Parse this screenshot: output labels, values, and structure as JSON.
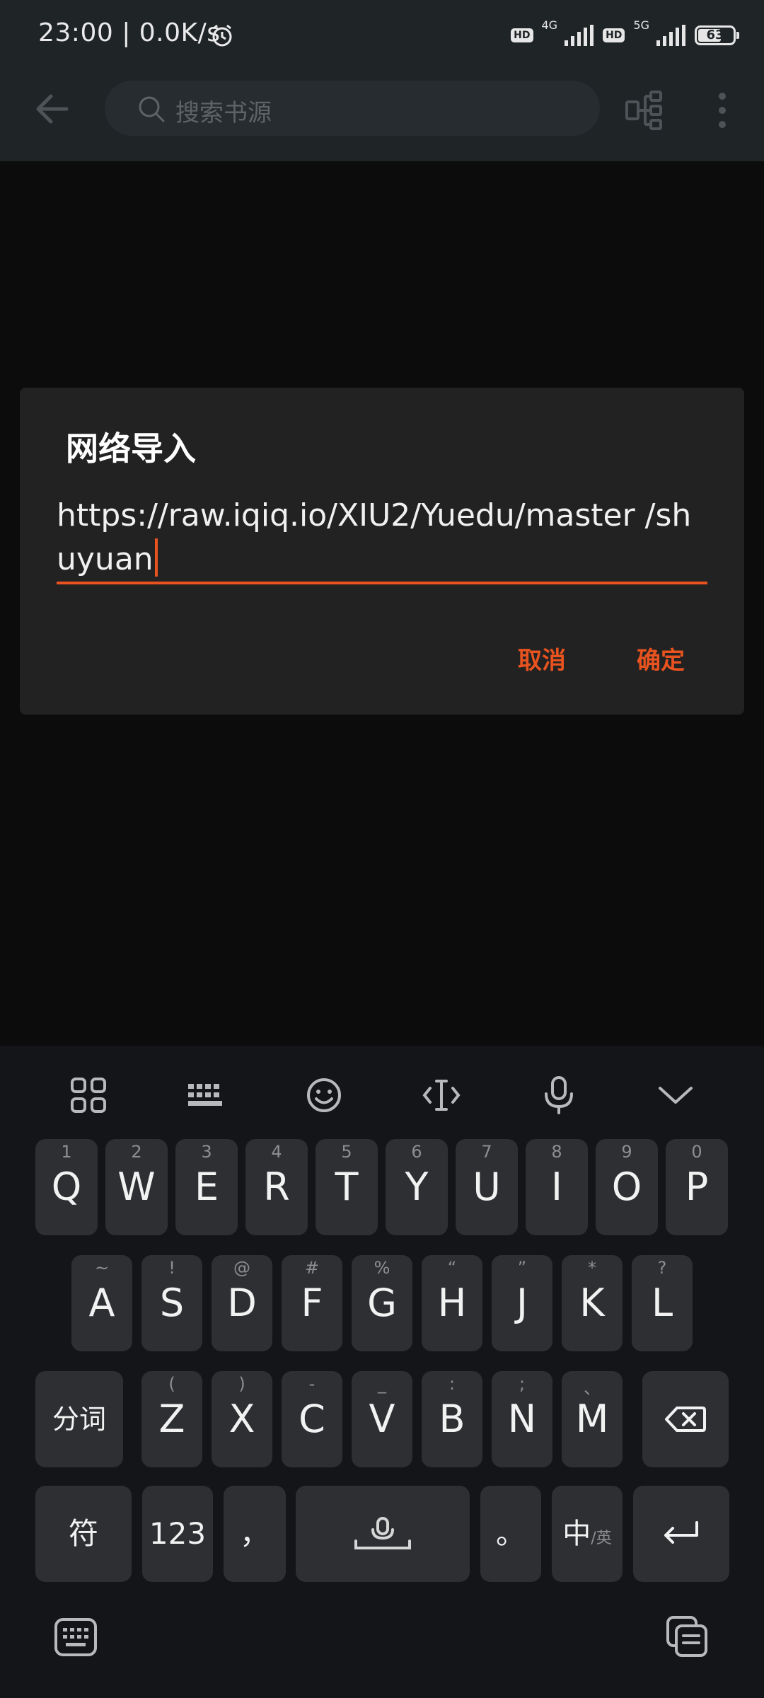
{
  "status_bar": {
    "time_speed": "23:00 | 0.0K/s",
    "hd1": "HD",
    "net1": "4G",
    "hd2": "HD",
    "net2": "5G",
    "battery": "63"
  },
  "app_bar": {
    "search_placeholder": "搜索书源"
  },
  "dialog": {
    "title": "网络导入",
    "url_value": "https://raw.iqiq.io/XIU2/Yuedu/master /shuyuan",
    "cancel_label": "取消",
    "confirm_label": "确定",
    "accent_color": "#e8531f"
  },
  "keyboard": {
    "toolbar_icons": [
      "apps-grid-icon",
      "keyboard-layout-icon",
      "emoji-icon",
      "cursor-move-icon",
      "microphone-icon",
      "collapse-chevron-icon"
    ],
    "row1": [
      {
        "sub": "1",
        "main": "Q"
      },
      {
        "sub": "2",
        "main": "W"
      },
      {
        "sub": "3",
        "main": "E"
      },
      {
        "sub": "4",
        "main": "R"
      },
      {
        "sub": "5",
        "main": "T"
      },
      {
        "sub": "6",
        "main": "Y"
      },
      {
        "sub": "7",
        "main": "U"
      },
      {
        "sub": "8",
        "main": "I"
      },
      {
        "sub": "9",
        "main": "O"
      },
      {
        "sub": "0",
        "main": "P"
      }
    ],
    "row2": [
      {
        "sub": "~",
        "main": "A"
      },
      {
        "sub": "!",
        "main": "S"
      },
      {
        "sub": "@",
        "main": "D"
      },
      {
        "sub": "#",
        "main": "F"
      },
      {
        "sub": "%",
        "main": "G"
      },
      {
        "sub": "“",
        "main": "H"
      },
      {
        "sub": "”",
        "main": "J"
      },
      {
        "sub": "*",
        "main": "K"
      },
      {
        "sub": "?",
        "main": "L"
      }
    ],
    "row3": {
      "left_label": "分词",
      "letters": [
        {
          "sub": "(",
          "main": "Z"
        },
        {
          "sub": ")",
          "main": "X"
        },
        {
          "sub": "-",
          "main": "C"
        },
        {
          "sub": "_",
          "main": "V"
        },
        {
          "sub": ":",
          "main": "B"
        },
        {
          "sub": ";",
          "main": "N"
        },
        {
          "sub": "、",
          "main": "M"
        }
      ]
    },
    "row4": {
      "symbols_label": "符",
      "numbers_label": "123",
      "comma_label": "，",
      "period_label": "。",
      "lang_label": "中",
      "lang_sub": "/英"
    }
  }
}
